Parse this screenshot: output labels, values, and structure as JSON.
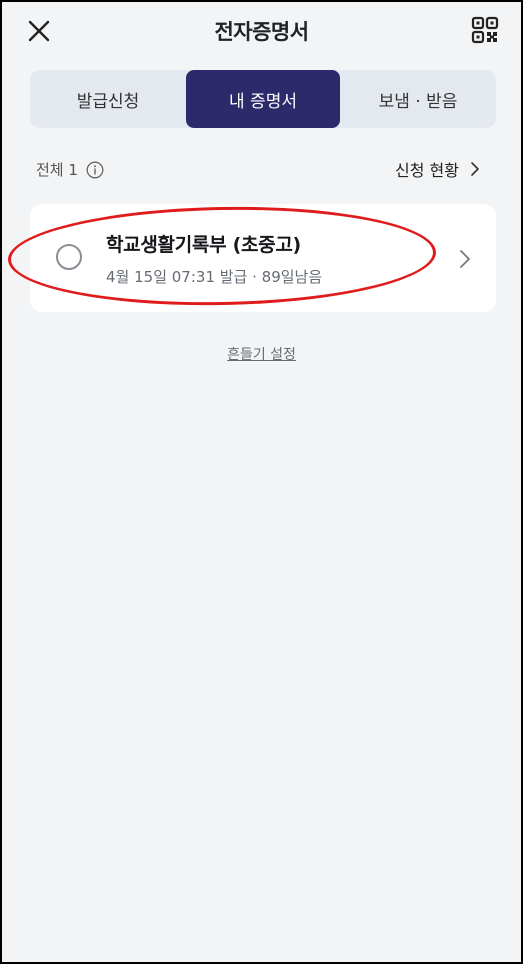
{
  "header": {
    "title": "전자증명서",
    "close_icon": "close-icon",
    "qr_icon": "qr-code-icon"
  },
  "tabs": [
    {
      "label": "발급신청",
      "active": false
    },
    {
      "label": "내 증명서",
      "active": true
    },
    {
      "label": "보냄 · 받음",
      "active": false
    }
  ],
  "summary": {
    "total_label": "전체 1",
    "status_link": "신청 현황"
  },
  "certificate": {
    "title": "학교생활기록부 (초중고)",
    "subtitle": "4월 15일 07:31 발급 · 89일남음"
  },
  "footer": {
    "shake_settings": "흔들기 설정"
  },
  "colors": {
    "accent": "#2d2a6b",
    "highlight": "#e01b1b",
    "background": "#f3f4f6"
  }
}
